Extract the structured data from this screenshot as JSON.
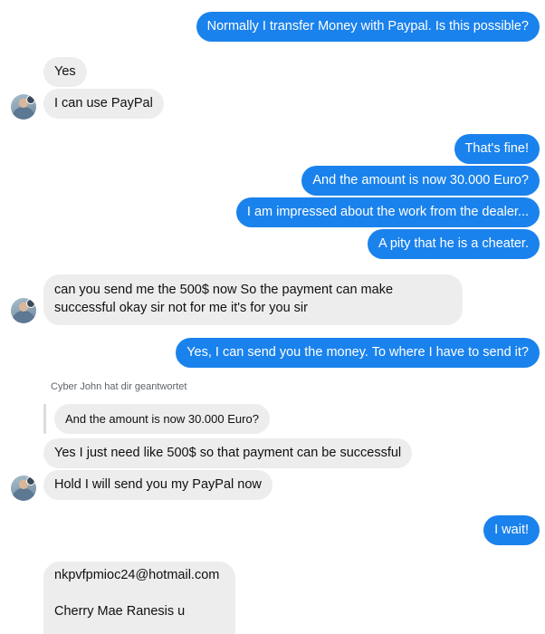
{
  "messages": {
    "m1": "Normally I transfer Money with Paypal. Is this possible?",
    "m2": "Yes",
    "m3": "I can use PayPal",
    "m4": "That's fine!",
    "m5": "And the amount is now 30.000 Euro?",
    "m6": "I am impressed about the work from the dealer...",
    "m7": "A pity that he is a cheater.",
    "m8": "can you send me the 500$ now So the payment can make successful okay sir not for me it's for you sir",
    "m9": "Yes, I can send you the money. To where I have to send it?",
    "reply_meta": "Cyber John hat dir geantwortet",
    "quoted": "And the amount is now 30.000 Euro?",
    "m10": "Yes I just need like 500$ so that payment can be successful",
    "m11": "Hold I will send you my PayPal now",
    "m12": "I wait!",
    "m13_line1": "nkpvfpmioc24@hotmail.com",
    "m13_line2": "Cherry Mae Ranesis u"
  },
  "colors": {
    "outgoing_bubble": "#1a82ec",
    "incoming_bubble": "#ededed"
  }
}
